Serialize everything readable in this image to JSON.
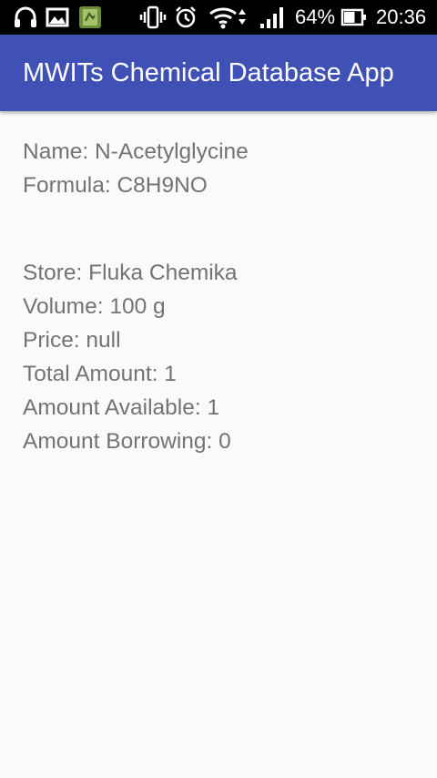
{
  "status_bar": {
    "battery_percent": "64%",
    "battery_level": 0.64,
    "time": "20:36"
  },
  "app_bar": {
    "title": "MWITs Chemical Database App"
  },
  "chemical": {
    "name_line": "Name: N-Acetylglycine",
    "formula_line": "Formula: C8H9NO",
    "store_line": "Store: Fluka Chemika",
    "volume_line": "Volume: 100 g",
    "price_line": "Price: null",
    "total_amount_line": "Total Amount: 1",
    "amount_available_line": "Amount Available: 1",
    "amount_borrowing_line": "Amount Borrowing: 0"
  }
}
